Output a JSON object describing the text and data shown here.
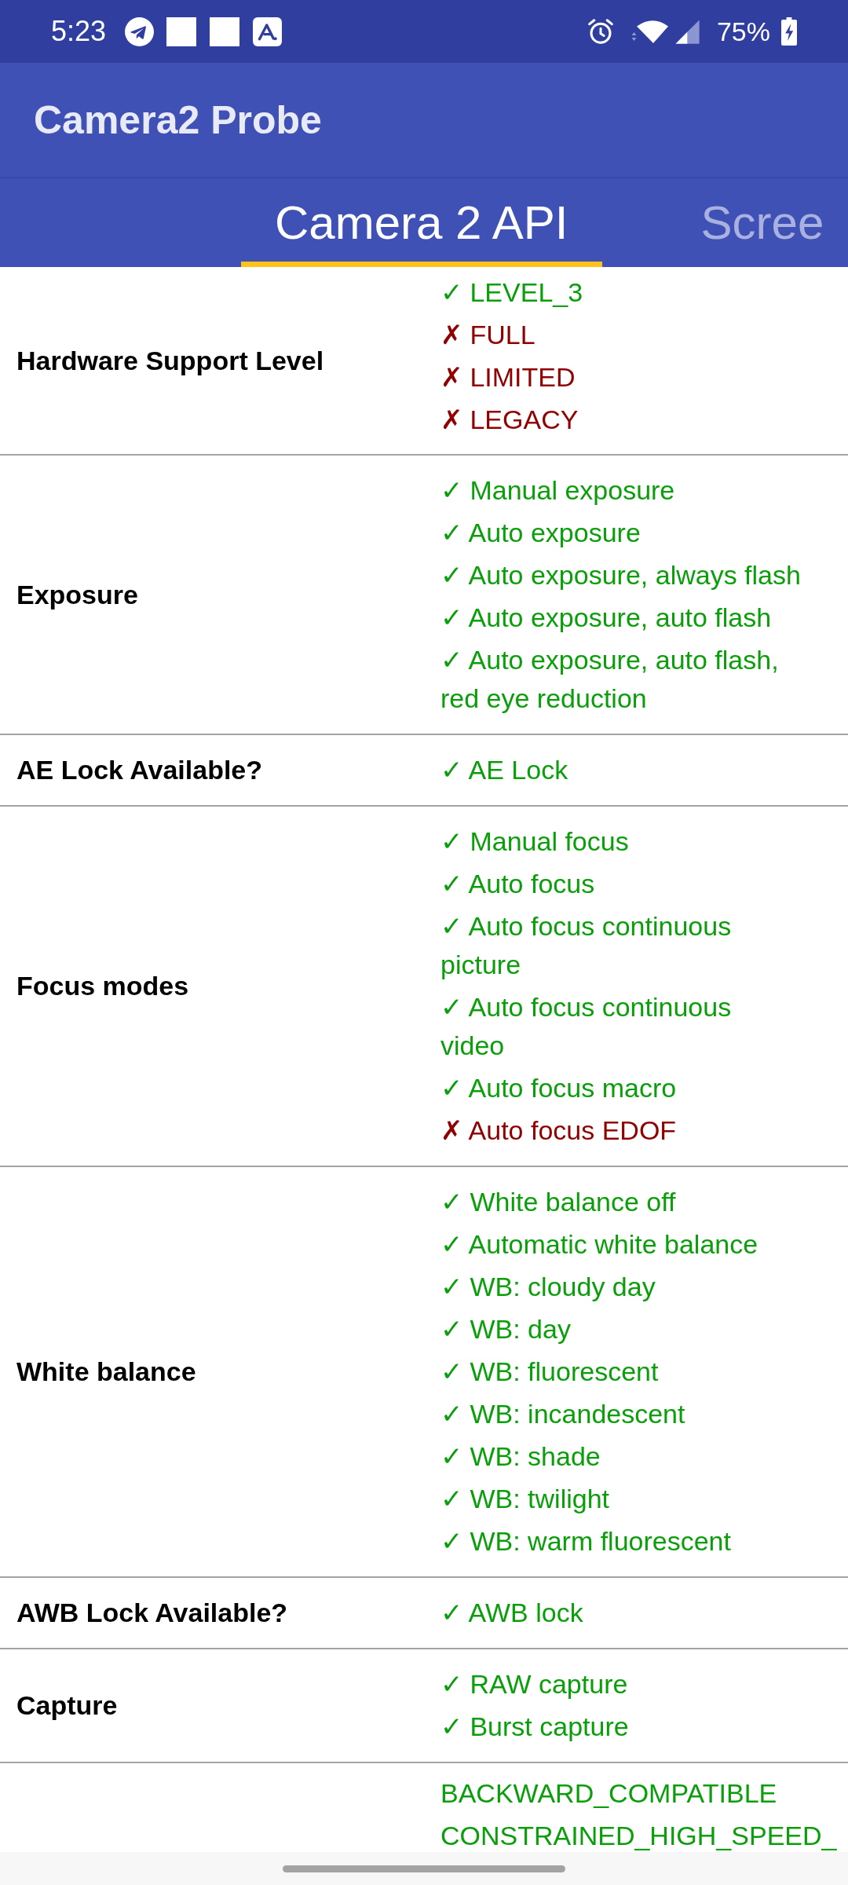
{
  "status_bar": {
    "time": "5:23",
    "battery": "75%"
  },
  "app_bar": {
    "title": "Camera2 Probe"
  },
  "tabs": [
    {
      "label": "Camera 2 API",
      "selected": true
    },
    {
      "label": "Scree",
      "selected": false
    }
  ],
  "rows": [
    {
      "label": "Hardware Support Level",
      "items": [
        {
          "text": "✓ LEVEL_3",
          "supported": true
        },
        {
          "text": "✗ FULL",
          "supported": false
        },
        {
          "text": "✗ LIMITED",
          "supported": false
        },
        {
          "text": "✗ LEGACY",
          "supported": false
        }
      ]
    },
    {
      "label": "Exposure",
      "items": [
        {
          "text": "✓ Manual exposure",
          "supported": true
        },
        {
          "text": "✓ Auto exposure",
          "supported": true
        },
        {
          "text": "✓ Auto exposure, always flash",
          "supported": true
        },
        {
          "text": "✓ Auto exposure, auto flash",
          "supported": true
        },
        {
          "text": "✓ Auto exposure, auto flash, red eye reduction",
          "supported": true
        }
      ]
    },
    {
      "label": "AE Lock Available?",
      "items": [
        {
          "text": "✓ AE Lock",
          "supported": true
        }
      ]
    },
    {
      "label": "Focus modes",
      "items": [
        {
          "text": "✓ Manual focus",
          "supported": true
        },
        {
          "text": "✓ Auto focus",
          "supported": true
        },
        {
          "text": "✓ Auto focus continuous picture",
          "supported": true
        },
        {
          "text": "✓ Auto focus continuous video",
          "supported": true
        },
        {
          "text": "✓ Auto focus macro",
          "supported": true
        },
        {
          "text": "✗ Auto focus EDOF",
          "supported": false
        }
      ]
    },
    {
      "label": "White balance",
      "items": [
        {
          "text": "✓ White balance off",
          "supported": true
        },
        {
          "text": "✓ Automatic white balance",
          "supported": true
        },
        {
          "text": "✓ WB: cloudy day",
          "supported": true
        },
        {
          "text": "✓ WB: day",
          "supported": true
        },
        {
          "text": "✓ WB: fluorescent",
          "supported": true
        },
        {
          "text": "✓ WB: incandescent",
          "supported": true
        },
        {
          "text": "✓ WB: shade",
          "supported": true
        },
        {
          "text": "✓ WB: twilight",
          "supported": true
        },
        {
          "text": "✓ WB: warm fluorescent",
          "supported": true
        }
      ]
    },
    {
      "label": "AWB Lock Available?",
      "items": [
        {
          "text": "✓ AWB lock",
          "supported": true
        }
      ]
    },
    {
      "label": "Capture",
      "items": [
        {
          "text": "✓ RAW capture",
          "supported": true
        },
        {
          "text": "✓ Burst capture",
          "supported": true
        }
      ]
    },
    {
      "items": [
        {
          "text": "BACKWARD_COMPATIBLE",
          "supported": true
        },
        {
          "text": "CONSTRAINED_HIGH_SPEED_",
          "supported": true
        }
      ]
    }
  ]
}
